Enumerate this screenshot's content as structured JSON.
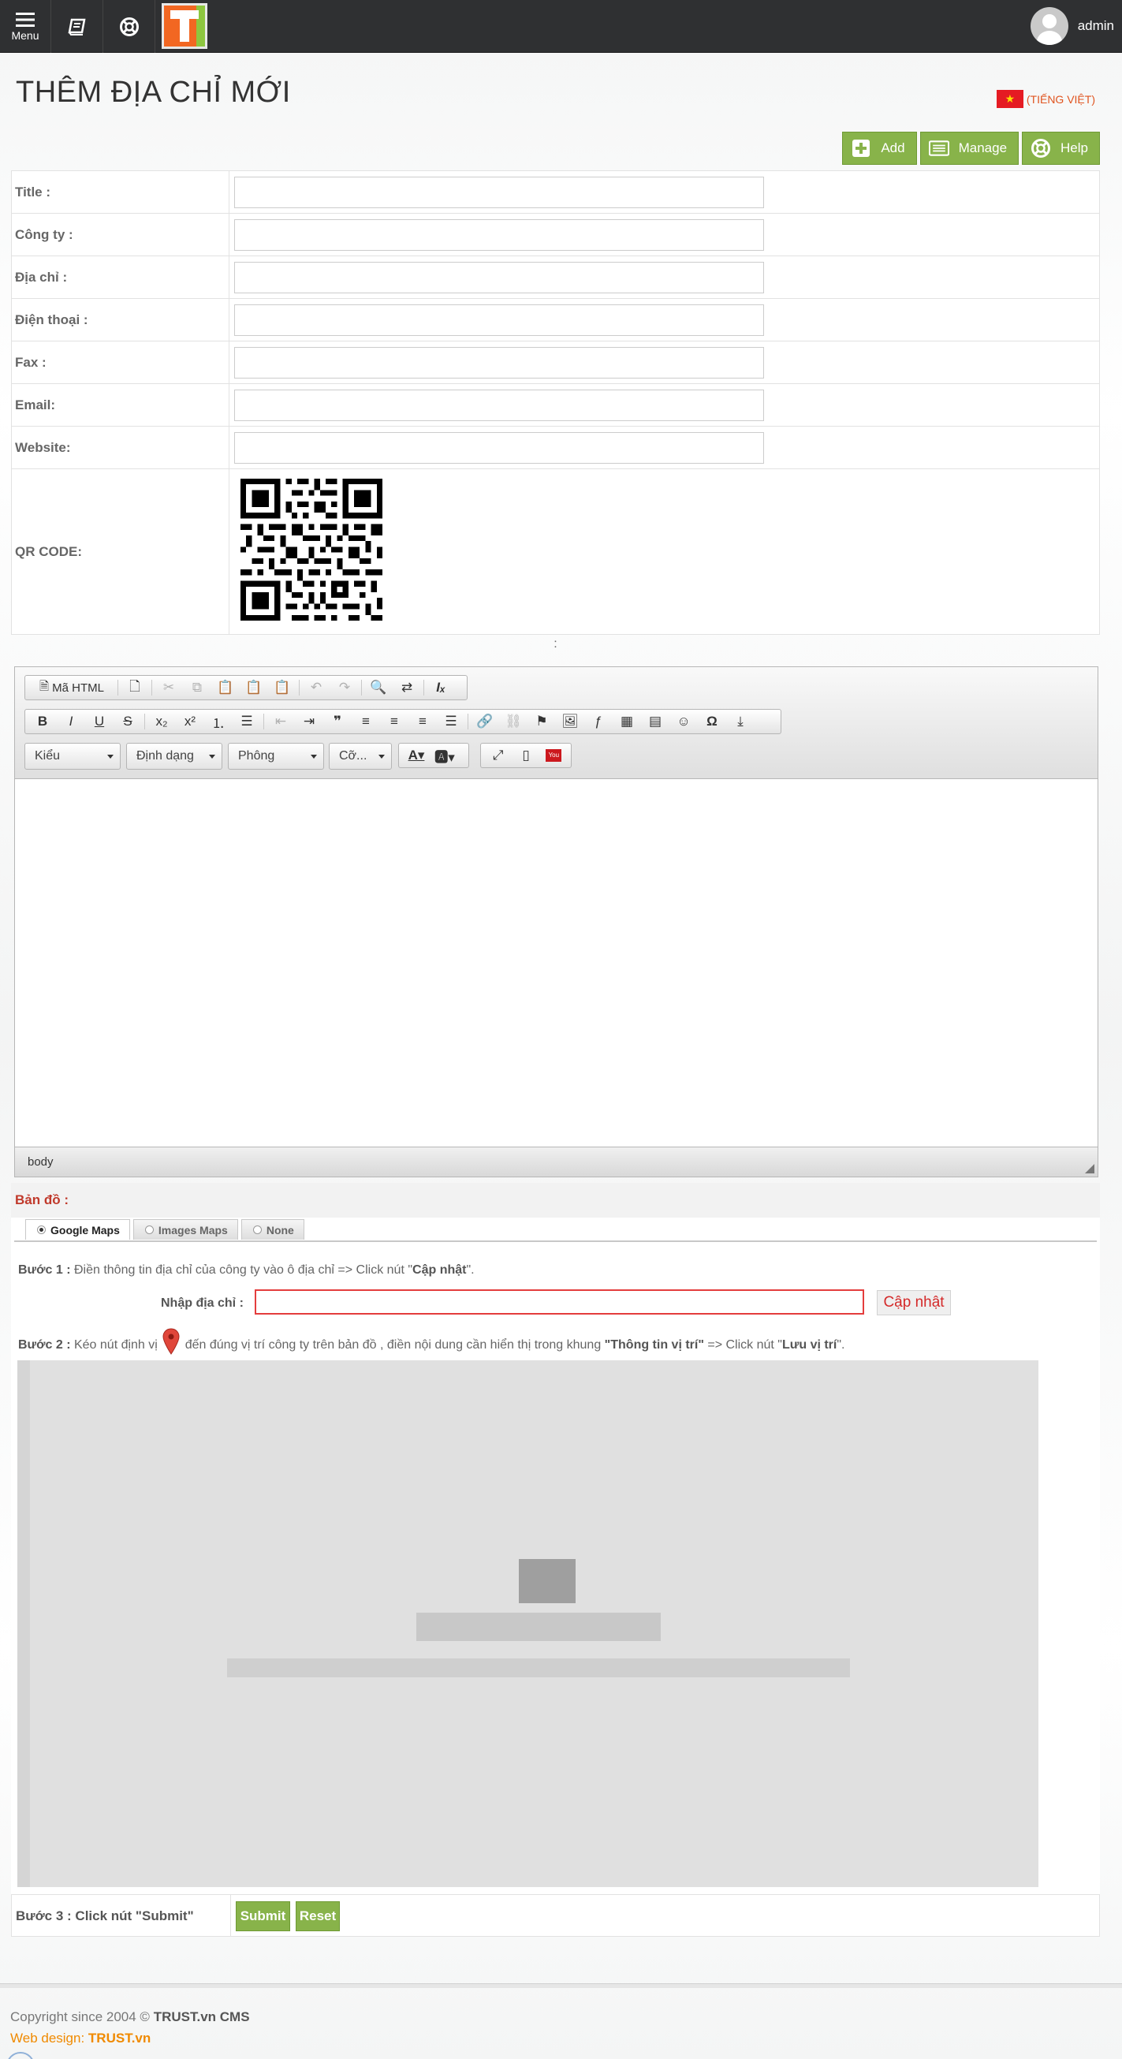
{
  "topbar": {
    "menu_label": "Menu",
    "user_name": "admin"
  },
  "page": {
    "title": "THÊM ĐỊA CHỈ MỚI",
    "language": "(TIẾNG VIỆT)"
  },
  "actions": {
    "add": "Add",
    "manage": "Manage",
    "help": "Help"
  },
  "form": {
    "fields": [
      {
        "label": "Title :",
        "value": ""
      },
      {
        "label": "Công ty :",
        "value": ""
      },
      {
        "label": "Địa chỉ :",
        "value": ""
      },
      {
        "label": "Điện thoại :",
        "value": ""
      },
      {
        "label": "Fax :",
        "value": ""
      },
      {
        "label": "Email:",
        "value": ""
      },
      {
        "label": "Website:",
        "value": ""
      }
    ],
    "qr_label": "QR CODE:",
    "colon_row": ":"
  },
  "editor": {
    "source_label": "Mã HTML",
    "dropdowns": {
      "style": "Kiểu",
      "format": "Định dạng",
      "font": "Phông",
      "size": "Cỡ..."
    },
    "footer_path": "body"
  },
  "map": {
    "section_label": "Bản đồ :",
    "tabs": [
      "Google Maps",
      "Images Maps",
      "None"
    ],
    "active_tab": "Google Maps",
    "step1": {
      "prefix": "Bước 1 :",
      "text": " Điền thông tin địa chỉ của công ty vào ô địa chỉ => Click nút \"",
      "button_ref": "Cập nhật",
      "suffix": "\"."
    },
    "address_label": "Nhập địa chỉ :",
    "address_value": "",
    "update_button": "Cập nhật",
    "step2": {
      "prefix": "Bước 2 :",
      "text_a": " Kéo nút định vị ",
      "text_b": " đến đúng vị trí công ty trên bản đồ , điền nội dung cần hiển thị trong khung ",
      "frame_ref": "\"Thông tin vị trí\"",
      "text_c": " => Click nút \"",
      "button_ref": "Lưu vị trí",
      "suffix": "\"."
    }
  },
  "step3": {
    "label": "Bước 3 : Click nút \"Submit\"",
    "submit": "Submit",
    "reset": "Reset"
  },
  "footer": {
    "copyright_prefix": "Copyright since 2004 © ",
    "copyright_brand": "TRUST.vn CMS",
    "webdesign_prefix": "Web design: ",
    "webdesign_brand": "TRUST.vn"
  },
  "colors": {
    "accent_green": "#88b34a",
    "topbar": "#2f3032",
    "logo_orange": "#f26722",
    "alert_red": "#e43d3d"
  }
}
